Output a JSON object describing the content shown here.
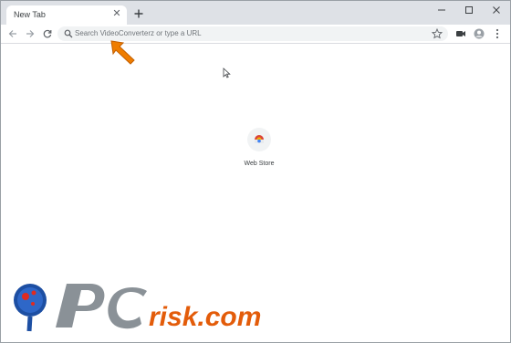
{
  "browser": {
    "tab": {
      "title": "New Tab"
    },
    "omnibox": {
      "placeholder": "Search VideoConverterz or type a URL"
    }
  },
  "newtab": {
    "shortcuts": [
      {
        "label": "Web Store"
      }
    ]
  },
  "watermark": {
    "text_pc": "PC",
    "text_rest": "risk.com"
  },
  "colors": {
    "tabstrip": "#dee1e6",
    "omnibox_bg": "#f1f3f4",
    "arrow": "#ef7d00",
    "watermark_gray": "#8a9197",
    "watermark_orange": "#e35c0a",
    "watermark_blue": "#1d4fa3"
  }
}
